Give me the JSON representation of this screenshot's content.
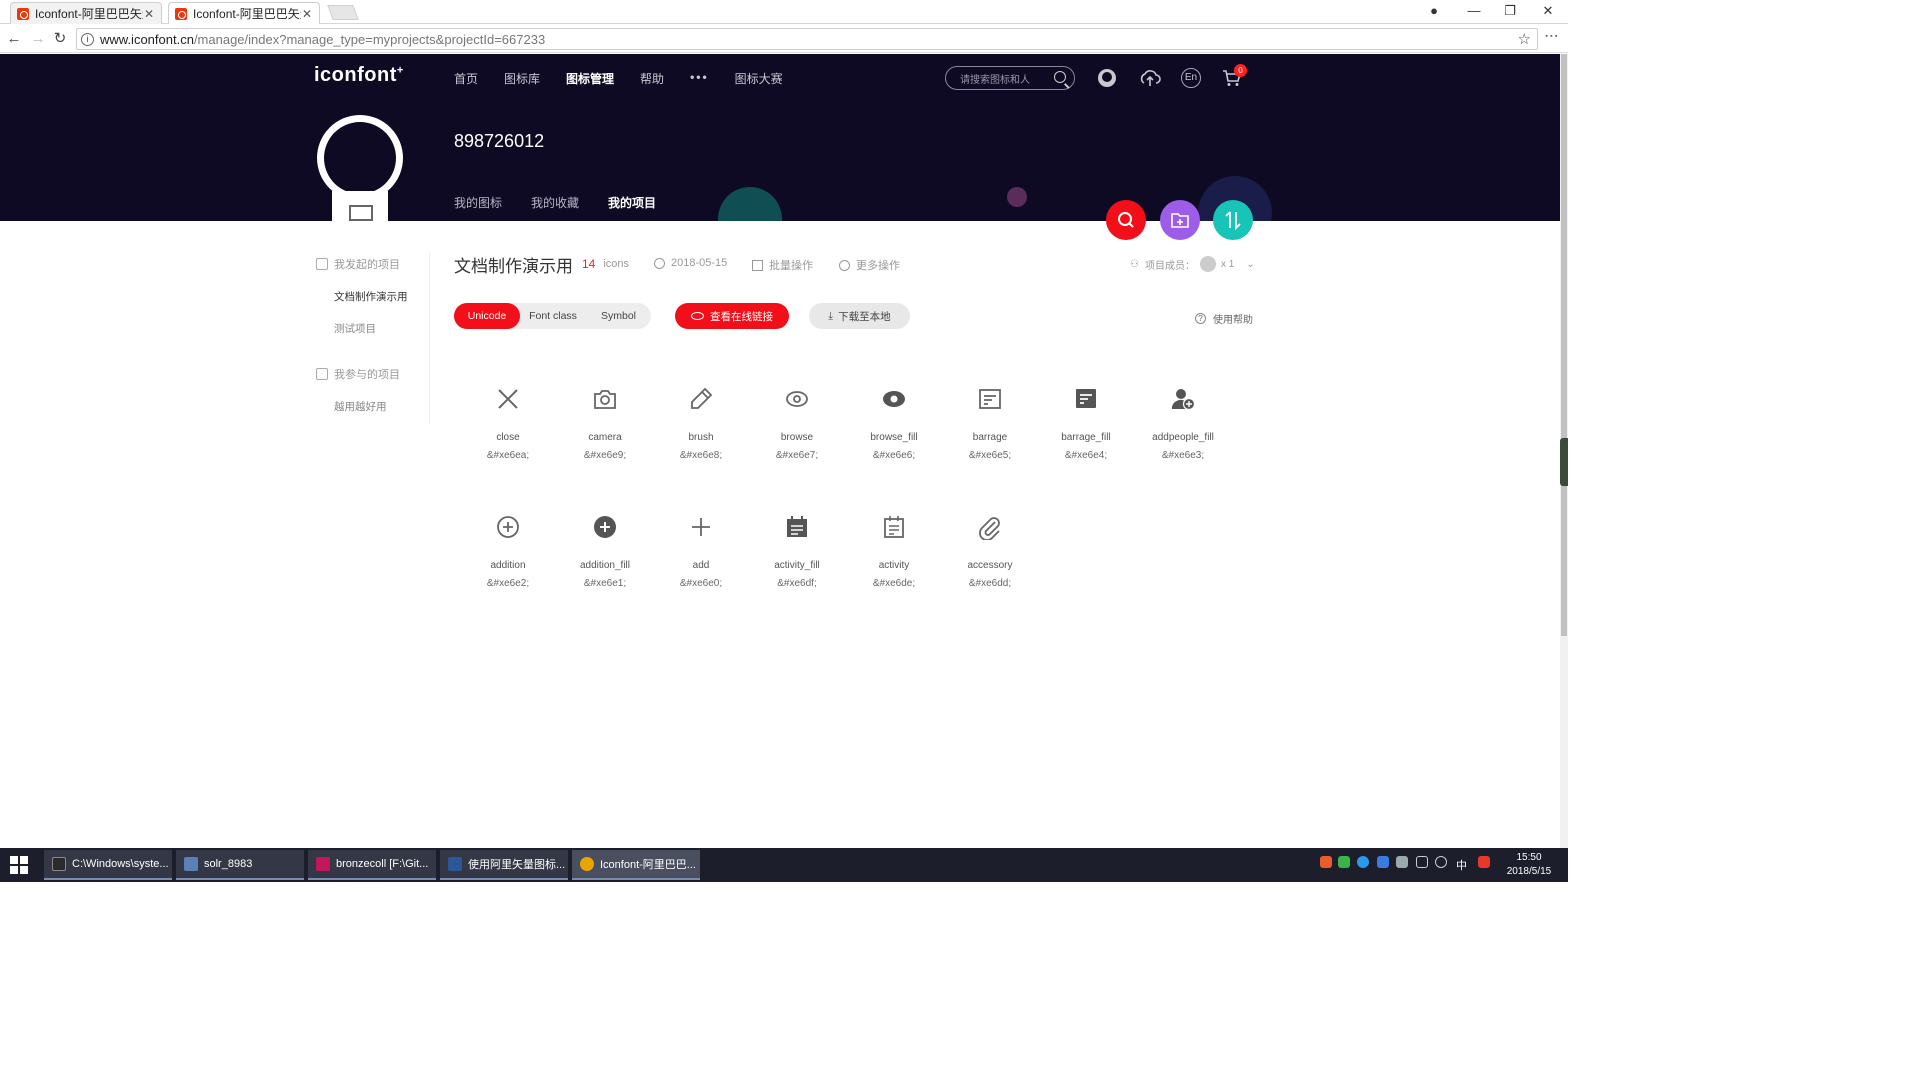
{
  "browser": {
    "tabs": [
      {
        "title": "Iconfont-阿里巴巴矢量图",
        "active": false
      },
      {
        "title": "Iconfont-阿里巴巴矢量图",
        "active": true
      }
    ],
    "url_host": "www.iconfont.cn",
    "url_path": "/manage/index?manage_type=myprojects&projectId=667233"
  },
  "site": {
    "logo": "iconfont",
    "logo_mark": "+",
    "nav": [
      "首页",
      "图标库",
      "图标管理",
      "帮助"
    ],
    "nav_more": "•••",
    "nav_extra": "图标大赛",
    "search_placeholder": "请搜索图标和人",
    "lang_label": "En",
    "cart_count": "0"
  },
  "profile": {
    "username": "898726012",
    "tabs": [
      "我的图标",
      "我的收藏",
      "我的项目"
    ],
    "active_tab": "我的项目"
  },
  "sidebar": {
    "group1": "我发起的项目",
    "group1_items": [
      "文档制作演示用",
      "测试项目"
    ],
    "group2": "我参与的项目",
    "group2_items": [
      "越用越好用"
    ]
  },
  "project": {
    "title": "文档制作演示用",
    "count": "14",
    "count_unit": "icons",
    "date": "2018-05-15",
    "batch": "批量操作",
    "more": "更多操作",
    "members_label": "项目成员：",
    "members_count": "x 1",
    "modes": [
      "Unicode",
      "Font class",
      "Symbol"
    ],
    "active_mode": "Unicode",
    "view_link": "查看在线链接",
    "download": "下载至本地",
    "help": "使用帮助"
  },
  "icons": [
    {
      "name": "close",
      "code": "&#xe6ea;",
      "glyph": "close"
    },
    {
      "name": "camera",
      "code": "&#xe6e9;",
      "glyph": "camera"
    },
    {
      "name": "brush",
      "code": "&#xe6e8;",
      "glyph": "brush"
    },
    {
      "name": "browse",
      "code": "&#xe6e7;",
      "glyph": "browse"
    },
    {
      "name": "browse_fill",
      "code": "&#xe6e6;",
      "glyph": "browse_fill"
    },
    {
      "name": "barrage",
      "code": "&#xe6e5;",
      "glyph": "barrage"
    },
    {
      "name": "barrage_fill",
      "code": "&#xe6e4;",
      "glyph": "barrage_fill"
    },
    {
      "name": "addpeople_fill",
      "code": "&#xe6e3;",
      "glyph": "addpeople_fill"
    },
    {
      "name": "addition",
      "code": "&#xe6e2;",
      "glyph": "addition"
    },
    {
      "name": "addition_fill",
      "code": "&#xe6e1;",
      "glyph": "addition_fill"
    },
    {
      "name": "add",
      "code": "&#xe6e0;",
      "glyph": "add"
    },
    {
      "name": "activity_fill",
      "code": "&#xe6df;",
      "glyph": "activity_fill"
    },
    {
      "name": "activity",
      "code": "&#xe6de;",
      "glyph": "activity"
    },
    {
      "name": "accessory",
      "code": "&#xe6dd;",
      "glyph": "accessory"
    }
  ],
  "taskbar": {
    "items": [
      {
        "label": "C:\\Windows\\syste...",
        "color": "#2b2b2b"
      },
      {
        "label": "solr_8983",
        "color": "#5b7fb8"
      },
      {
        "label": "bronzecoll [F:\\Git...",
        "color": "#c2185b"
      },
      {
        "label": "使用阿里矢量图标...",
        "color": "#2b5797"
      },
      {
        "label": "Iconfont-阿里巴巴...",
        "color": "#e8a400"
      }
    ],
    "ime": "中",
    "time": "15:50",
    "date": "2018/5/15"
  },
  "colors": {
    "header_bg": "#0e0a24",
    "accent_red": "#f20f19",
    "fab_search": "#f20f19",
    "fab_folder": "#9d5de8",
    "fab_sort": "#18c3b8"
  }
}
